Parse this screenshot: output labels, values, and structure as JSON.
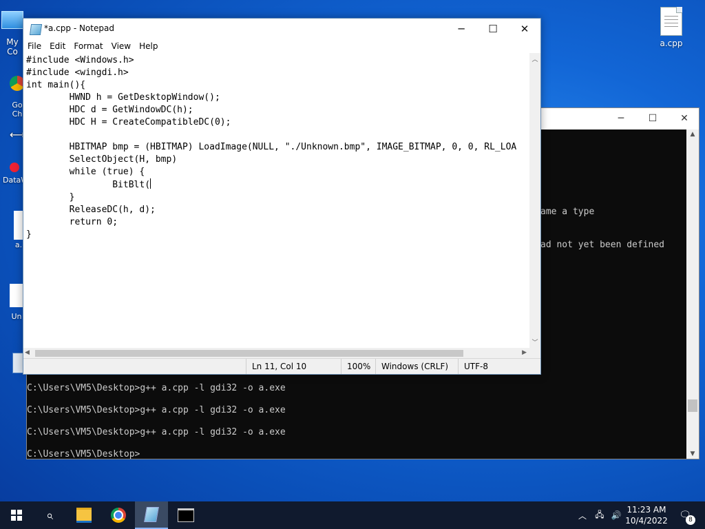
{
  "desktop": {
    "icons": [
      {
        "label": "My Co"
      },
      {
        "label": "Go"
      },
      {
        "label": "Ch"
      },
      {
        "label": "DataW"
      },
      {
        "label": "a."
      },
      {
        "label": "Un"
      },
      {
        "label": "a.cpp"
      }
    ]
  },
  "console": {
    "lines": [
      "ame a type",
      "ad not yet been defined",
      "C:\\Users\\VM5\\Desktop>g++ a.cpp -l gdi32 -o a.exe",
      "C:\\Users\\VM5\\Desktop>g++ a.cpp -l gdi32 -o a.exe",
      "C:\\Users\\VM5\\Desktop>g++ a.cpp -l gdi32 -o a.exe",
      "C:\\Users\\VM5\\Desktop>"
    ]
  },
  "notepad": {
    "title": "*a.cpp - Notepad",
    "menu": [
      "File",
      "Edit",
      "Format",
      "View",
      "Help"
    ],
    "code_before_caret": "#include <Windows.h>\n#include <wingdi.h>\nint main(){\n\tHWND h = GetDesktopWindow();\n\tHDC d = GetWindowDC(h);\n\tHDC H = CreateCompatibleDC(0);\n\n\tHBITMAP bmp = (HBITMAP) LoadImage(NULL, \"./Unknown.bmp\", IMAGE_BITMAP, 0, 0, RL_LOA\n\tSelectObject(H, bmp)\n\twhile (true) {\n\t\tBitBlt(",
    "code_after_caret": "\n\t}\n\tReleaseDC(h, d);\n\treturn 0;\n}",
    "status": {
      "position": "Ln 11, Col 10",
      "zoom": "100%",
      "line_ending": "Windows (CRLF)",
      "encoding": "UTF-8"
    }
  },
  "taskbar": {
    "time": "11:23 AM",
    "date": "10/4/2022",
    "notification_count": "8"
  }
}
